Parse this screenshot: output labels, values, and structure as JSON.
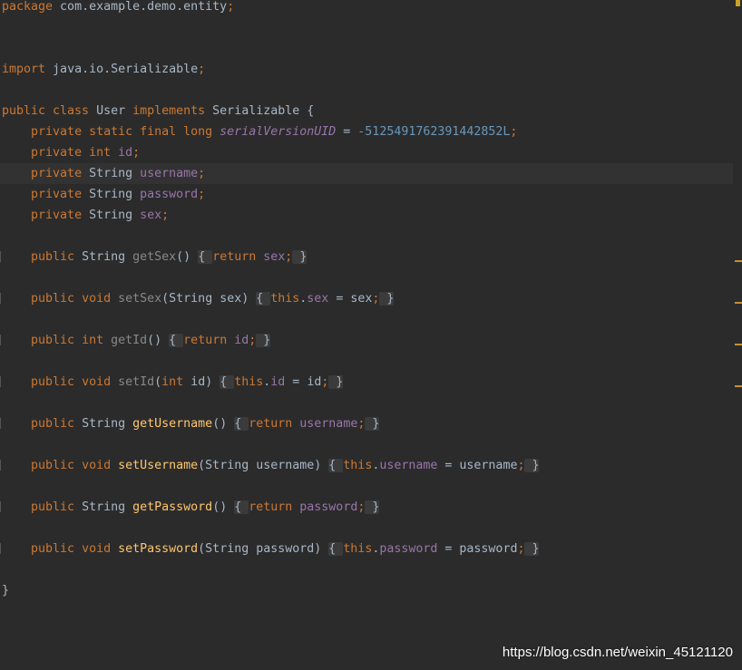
{
  "editor": {
    "theme": {
      "background": "#2b2b2b",
      "caret_row": "#323232",
      "text": "#a9b7c6",
      "keyword": "#cc7832",
      "field": "#9876aa",
      "number": "#6897bb",
      "method": "#ffc66d",
      "unused": "#86888a",
      "fold_bg": "#3b3b3b",
      "warning_marker": "#c7902e",
      "status_marker": "#c9a227"
    },
    "caret_line": 8,
    "status_icon": "inspection-status-icon",
    "lines": [
      {
        "tokens": [
          {
            "t": "package",
            "k": "kw"
          },
          {
            "t": " com.example.demo.entity",
            "k": "plain"
          },
          {
            "t": ";",
            "k": "kw"
          }
        ]
      },
      {
        "tokens": []
      },
      {
        "tokens": []
      },
      {
        "tokens": [
          {
            "t": "import",
            "k": "kw"
          },
          {
            "t": " java.io.Serializable",
            "k": "plain"
          },
          {
            "t": ";",
            "k": "kw"
          }
        ]
      },
      {
        "tokens": []
      },
      {
        "tokens": [
          {
            "t": "public class ",
            "k": "kw"
          },
          {
            "t": "User ",
            "k": "plain"
          },
          {
            "t": "implements ",
            "k": "kw"
          },
          {
            "t": "Serializable {",
            "k": "plain"
          }
        ]
      },
      {
        "tokens": [
          {
            "t": "    ",
            "k": "plain"
          },
          {
            "t": "private static final long ",
            "k": "kw"
          },
          {
            "t": "serialVersionUID",
            "k": "const"
          },
          {
            "t": " = ",
            "k": "plain"
          },
          {
            "t": "-5125491762391442852L",
            "k": "num"
          },
          {
            "t": ";",
            "k": "kw"
          }
        ]
      },
      {
        "tokens": [
          {
            "t": "    ",
            "k": "plain"
          },
          {
            "t": "private int ",
            "k": "kw"
          },
          {
            "t": "id",
            "k": "field"
          },
          {
            "t": ";",
            "k": "kw"
          }
        ]
      },
      {
        "tokens": [
          {
            "t": "    ",
            "k": "plain"
          },
          {
            "t": "private ",
            "k": "kw"
          },
          {
            "t": "String ",
            "k": "plain"
          },
          {
            "t": "username",
            "k": "field"
          },
          {
            "t": ";",
            "k": "kw"
          }
        ]
      },
      {
        "tokens": [
          {
            "t": "    ",
            "k": "plain"
          },
          {
            "t": "private ",
            "k": "kw"
          },
          {
            "t": "String ",
            "k": "plain"
          },
          {
            "t": "password",
            "k": "field"
          },
          {
            "t": ";",
            "k": "kw"
          }
        ]
      },
      {
        "tokens": [
          {
            "t": "    ",
            "k": "plain"
          },
          {
            "t": "private ",
            "k": "kw"
          },
          {
            "t": "String ",
            "k": "plain"
          },
          {
            "t": "sex",
            "k": "field"
          },
          {
            "t": ";",
            "k": "kw"
          }
        ]
      },
      {
        "tokens": []
      },
      {
        "fold_marker": true,
        "warning": true,
        "tokens": [
          {
            "t": "    ",
            "k": "plain"
          },
          {
            "t": "public ",
            "k": "kw"
          },
          {
            "t": "String ",
            "k": "plain"
          },
          {
            "t": "getSex",
            "k": "unused"
          },
          {
            "t": "() ",
            "k": "plain"
          },
          {
            "t": "{ ",
            "k": "fold"
          },
          {
            "t": "return ",
            "k": "kw"
          },
          {
            "t": "sex",
            "k": "field"
          },
          {
            "t": ";",
            "k": "kw"
          },
          {
            "t": " }",
            "k": "fold"
          }
        ]
      },
      {
        "tokens": []
      },
      {
        "fold_marker": true,
        "warning": true,
        "tokens": [
          {
            "t": "    ",
            "k": "plain"
          },
          {
            "t": "public void ",
            "k": "kw"
          },
          {
            "t": "setSex",
            "k": "unused"
          },
          {
            "t": "(String sex) ",
            "k": "plain"
          },
          {
            "t": "{ ",
            "k": "fold"
          },
          {
            "t": "this",
            "k": "kw"
          },
          {
            "t": ".",
            "k": "plain"
          },
          {
            "t": "sex",
            "k": "field"
          },
          {
            "t": " = sex",
            "k": "plain"
          },
          {
            "t": ";",
            "k": "kw"
          },
          {
            "t": " }",
            "k": "fold"
          }
        ]
      },
      {
        "tokens": []
      },
      {
        "fold_marker": true,
        "warning": true,
        "tokens": [
          {
            "t": "    ",
            "k": "plain"
          },
          {
            "t": "public int ",
            "k": "kw"
          },
          {
            "t": "getId",
            "k": "unused"
          },
          {
            "t": "() ",
            "k": "plain"
          },
          {
            "t": "{ ",
            "k": "fold"
          },
          {
            "t": "return ",
            "k": "kw"
          },
          {
            "t": "id",
            "k": "field"
          },
          {
            "t": ";",
            "k": "kw"
          },
          {
            "t": " }",
            "k": "fold"
          }
        ]
      },
      {
        "tokens": []
      },
      {
        "fold_marker": true,
        "warning": true,
        "tokens": [
          {
            "t": "    ",
            "k": "plain"
          },
          {
            "t": "public void ",
            "k": "kw"
          },
          {
            "t": "setId",
            "k": "unused"
          },
          {
            "t": "(",
            "k": "plain"
          },
          {
            "t": "int ",
            "k": "kw"
          },
          {
            "t": "id) ",
            "k": "plain"
          },
          {
            "t": "{ ",
            "k": "fold"
          },
          {
            "t": "this",
            "k": "kw"
          },
          {
            "t": ".",
            "k": "plain"
          },
          {
            "t": "id",
            "k": "field"
          },
          {
            "t": " = id",
            "k": "plain"
          },
          {
            "t": ";",
            "k": "kw"
          },
          {
            "t": " }",
            "k": "fold"
          }
        ]
      },
      {
        "tokens": []
      },
      {
        "fold_marker": true,
        "tokens": [
          {
            "t": "    ",
            "k": "plain"
          },
          {
            "t": "public ",
            "k": "kw"
          },
          {
            "t": "String ",
            "k": "plain"
          },
          {
            "t": "getUsername",
            "k": "method"
          },
          {
            "t": "() ",
            "k": "plain"
          },
          {
            "t": "{ ",
            "k": "fold"
          },
          {
            "t": "return ",
            "k": "kw"
          },
          {
            "t": "username",
            "k": "field"
          },
          {
            "t": ";",
            "k": "kw"
          },
          {
            "t": " }",
            "k": "fold"
          }
        ]
      },
      {
        "tokens": []
      },
      {
        "fold_marker": true,
        "tokens": [
          {
            "t": "    ",
            "k": "plain"
          },
          {
            "t": "public void ",
            "k": "kw"
          },
          {
            "t": "setUsername",
            "k": "method"
          },
          {
            "t": "(String username) ",
            "k": "plain"
          },
          {
            "t": "{ ",
            "k": "fold"
          },
          {
            "t": "this",
            "k": "kw"
          },
          {
            "t": ".",
            "k": "plain"
          },
          {
            "t": "username",
            "k": "field"
          },
          {
            "t": " = username",
            "k": "plain"
          },
          {
            "t": ";",
            "k": "kw"
          },
          {
            "t": " }",
            "k": "fold"
          }
        ]
      },
      {
        "tokens": []
      },
      {
        "fold_marker": true,
        "tokens": [
          {
            "t": "    ",
            "k": "plain"
          },
          {
            "t": "public ",
            "k": "kw"
          },
          {
            "t": "String ",
            "k": "plain"
          },
          {
            "t": "getPassword",
            "k": "method"
          },
          {
            "t": "() ",
            "k": "plain"
          },
          {
            "t": "{ ",
            "k": "fold"
          },
          {
            "t": "return ",
            "k": "kw"
          },
          {
            "t": "password",
            "k": "field"
          },
          {
            "t": ";",
            "k": "kw"
          },
          {
            "t": " }",
            "k": "fold"
          }
        ]
      },
      {
        "tokens": []
      },
      {
        "fold_marker": true,
        "tokens": [
          {
            "t": "    ",
            "k": "plain"
          },
          {
            "t": "public void ",
            "k": "kw"
          },
          {
            "t": "setPassword",
            "k": "method"
          },
          {
            "t": "(String password) ",
            "k": "plain"
          },
          {
            "t": "{ ",
            "k": "fold"
          },
          {
            "t": "this",
            "k": "kw"
          },
          {
            "t": ".",
            "k": "plain"
          },
          {
            "t": "password",
            "k": "field"
          },
          {
            "t": " = password",
            "k": "plain"
          },
          {
            "t": ";",
            "k": "kw"
          },
          {
            "t": " }",
            "k": "fold"
          }
        ]
      },
      {
        "tokens": []
      },
      {
        "tokens": [
          {
            "t": "}",
            "k": "plain"
          }
        ]
      }
    ]
  },
  "watermark": {
    "text": "https://blog.csdn.net/weixin_45121120"
  }
}
